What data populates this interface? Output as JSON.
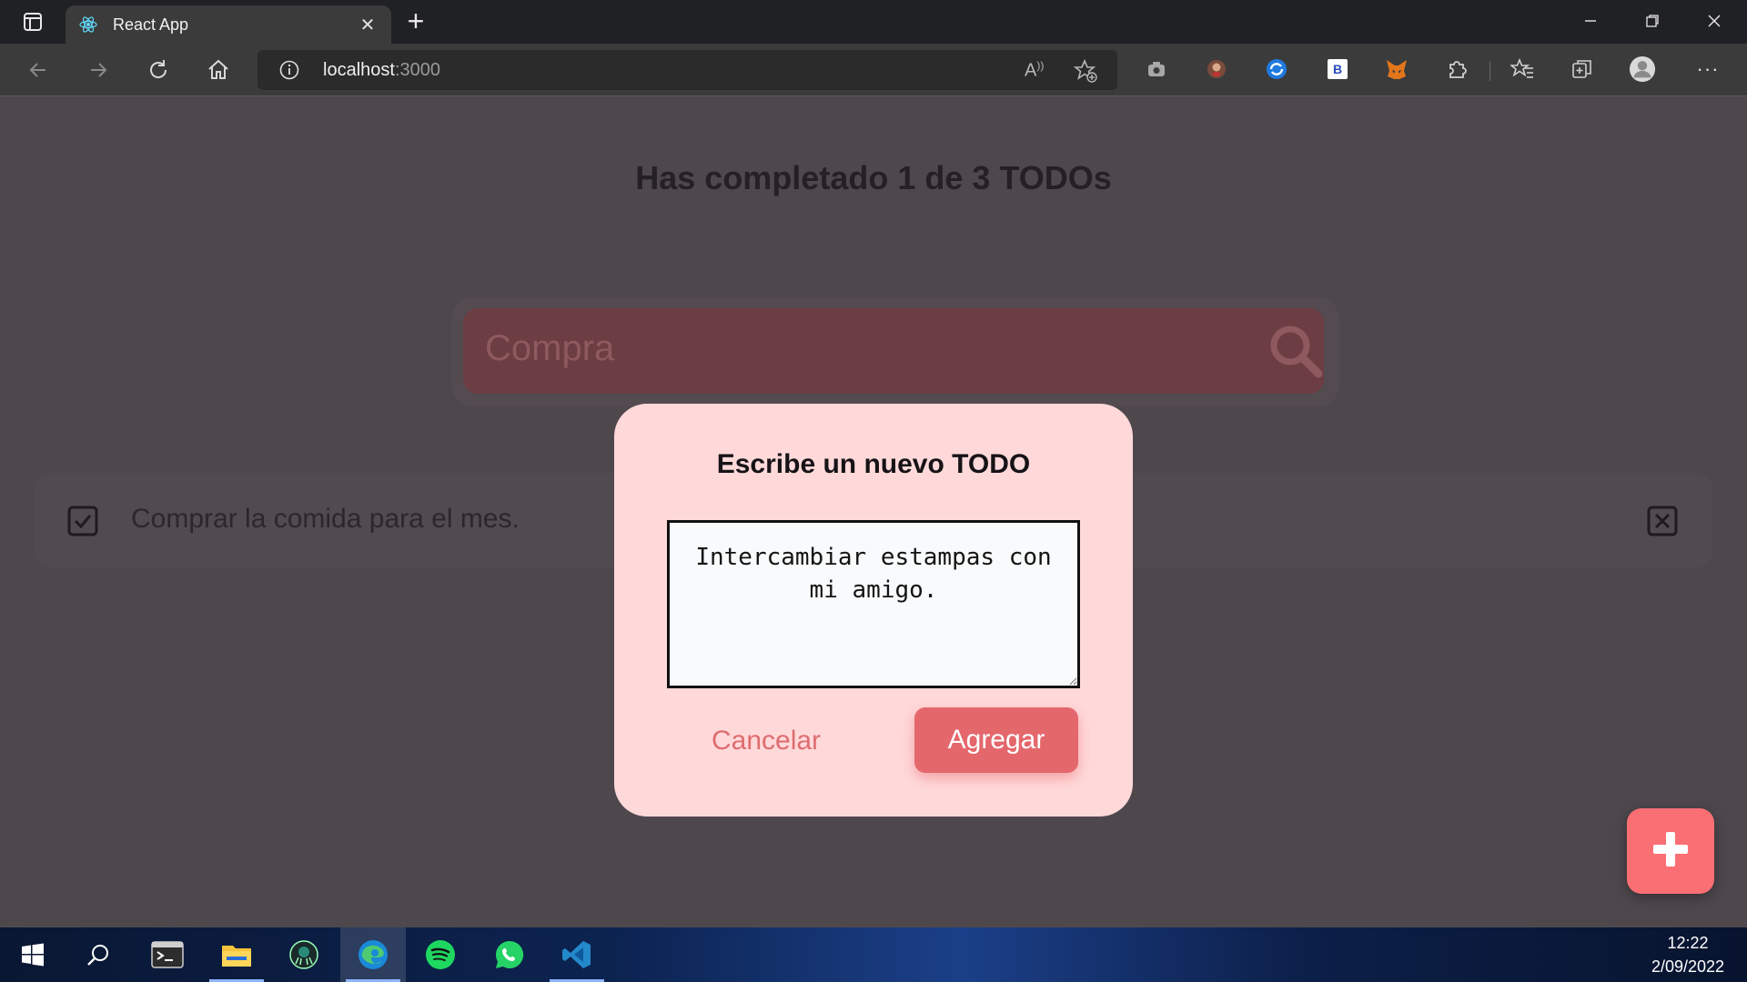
{
  "browser": {
    "tab_title": "React App",
    "url_host": "localhost",
    "url_port": ":3000"
  },
  "page": {
    "counter_text": "Has completado 1 de 3 TODOs",
    "search_value": "Compra",
    "todos": [
      {
        "text": "Comprar la comida para el mes.",
        "completed": true
      }
    ]
  },
  "modal": {
    "title": "Escribe un nuevo TODO",
    "textarea_value": "Intercambiar estampas con mi amigo.",
    "cancel_label": "Cancelar",
    "add_label": "Agregar"
  },
  "taskbar": {
    "time": "12:22",
    "date": "2/09/2022"
  },
  "colors": {
    "modal_bg": "#ffd9da",
    "accent": "#e4676c",
    "fab": "#fa6f74",
    "overlay_page": "#4e484d"
  }
}
